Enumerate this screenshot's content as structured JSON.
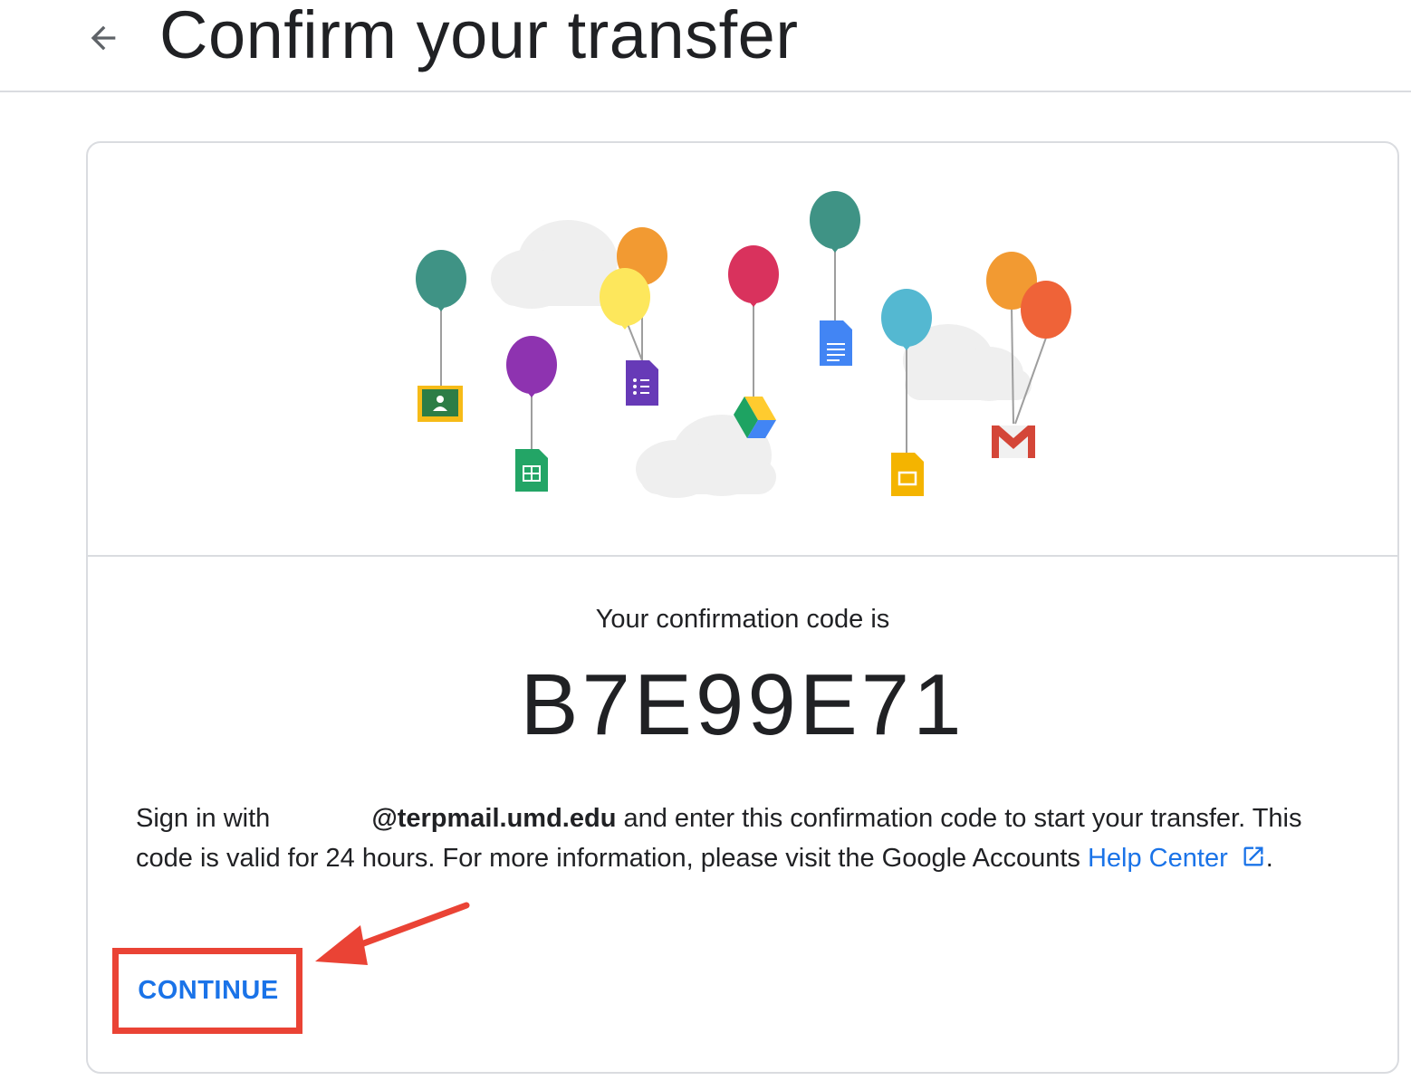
{
  "header": {
    "title": "Confirm your transfer",
    "back_icon": "arrow-back-icon"
  },
  "illustration": {
    "balloons": [
      {
        "color": "#3f9385",
        "item": "classroom-icon"
      },
      {
        "color": "#8e33b0",
        "item": "sheets-icon"
      },
      {
        "color": "#f29a32",
        "item": "forms-icon"
      },
      {
        "color": "#fde75c",
        "item": "forms-icon"
      },
      {
        "color": "#d9325d",
        "item": "drive-icon"
      },
      {
        "color": "#3f9385",
        "item": "docs-icon"
      },
      {
        "color": "#54b8d1",
        "item": "slides-icon"
      },
      {
        "color": "#f29a32",
        "item": "gmail-icon"
      },
      {
        "color": "#ef6338",
        "item": "gmail-icon"
      }
    ]
  },
  "confirmation": {
    "label": "Your confirmation code is",
    "code": "B7E99E71"
  },
  "instructions": {
    "prefix": "Sign in with",
    "email_domain": "@terpmail.umd.edu",
    "middle": "and enter this confirmation code to start your transfer. This code is valid for 24 hours. For more information, please visit the Google Accounts",
    "link_text": "Help Center",
    "suffix": "."
  },
  "actions": {
    "continue_label": "CONTINUE"
  },
  "colors": {
    "accent": "#1a73e8",
    "annotation": "#ea4335",
    "divider": "#dadce0"
  }
}
